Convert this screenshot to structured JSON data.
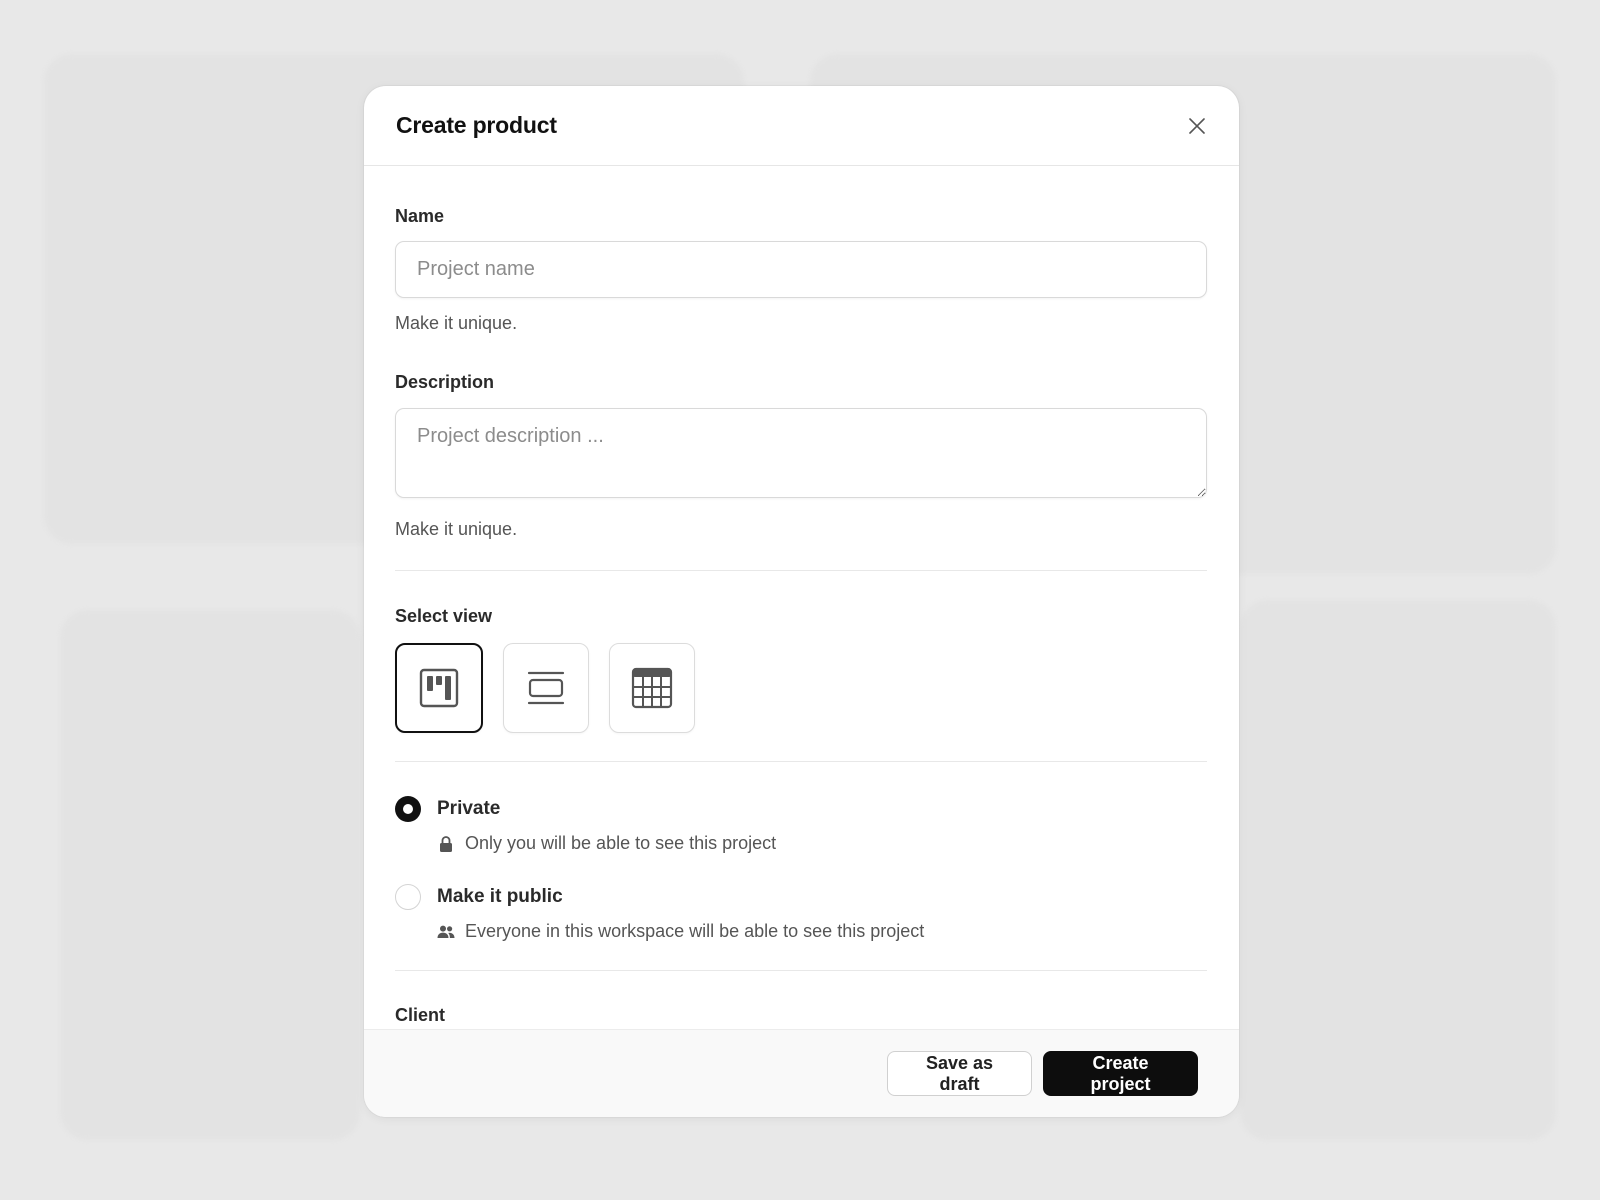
{
  "modal": {
    "title": "Create product",
    "close_icon": "close-icon"
  },
  "form": {
    "name": {
      "label": "Name",
      "value": "",
      "placeholder": "Project name",
      "hint": "Make it unique."
    },
    "description": {
      "label": "Description",
      "value": "",
      "placeholder": "Project description ...",
      "hint": "Make it unique."
    },
    "view": {
      "label": "Select view",
      "options": [
        {
          "icon": "kanban-board-icon",
          "selected": true
        },
        {
          "icon": "list-view-icon",
          "selected": false
        },
        {
          "icon": "table-view-icon",
          "selected": false
        }
      ]
    },
    "visibility": {
      "options": [
        {
          "label": "Private",
          "description": "Only you will be able to see this project",
          "icon": "lock-icon",
          "checked": true
        },
        {
          "label": "Make it public",
          "description": "Everyone in this workspace will be able to see this project",
          "icon": "users-icon",
          "checked": false
        }
      ]
    },
    "client": {
      "label": "Client"
    }
  },
  "footer": {
    "draft_label": "Save as draft",
    "create_label": "Create project"
  },
  "colors": {
    "background": "#e8e8e8",
    "primary": "#0d0d0d",
    "border": "#d9d9d9"
  }
}
